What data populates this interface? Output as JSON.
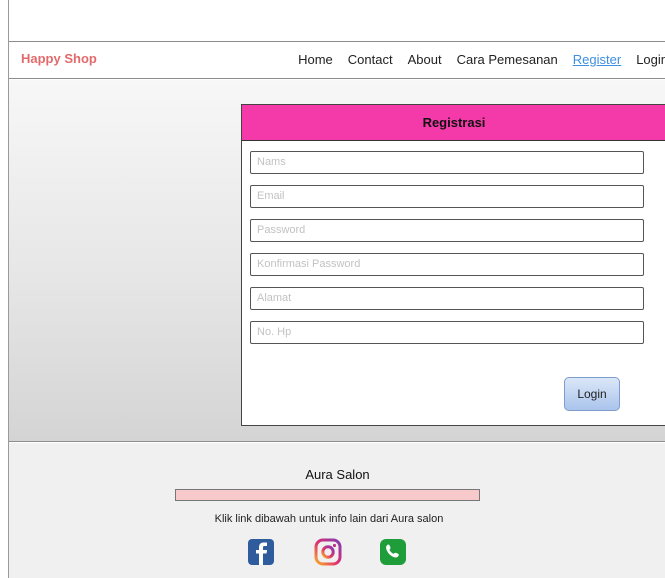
{
  "header": {
    "brand": "Happy Shop",
    "nav": [
      "Home",
      "Contact",
      "About",
      "Cara Pemesanan",
      "Register",
      "Login"
    ]
  },
  "form": {
    "title": "Registrasi",
    "fields": [
      {
        "placeholder": "Nams"
      },
      {
        "placeholder": "Email"
      },
      {
        "placeholder": "Password"
      },
      {
        "placeholder": "Konfirmasi Password"
      },
      {
        "placeholder": "Alamat"
      },
      {
        "placeholder": "No. Hp"
      }
    ],
    "submit_label": "Login"
  },
  "footer": {
    "title": "Aura Salon",
    "text": "Klik link dibawah untuk info lain dari Aura salon",
    "social": [
      "facebook-icon",
      "instagram-icon",
      "whatsapp-icon"
    ]
  },
  "colors": {
    "brand": "#e36a6a",
    "active_link": "#3d8fe0",
    "form_header": "#f43aa8",
    "footer_bar": "#f8c9cb"
  }
}
